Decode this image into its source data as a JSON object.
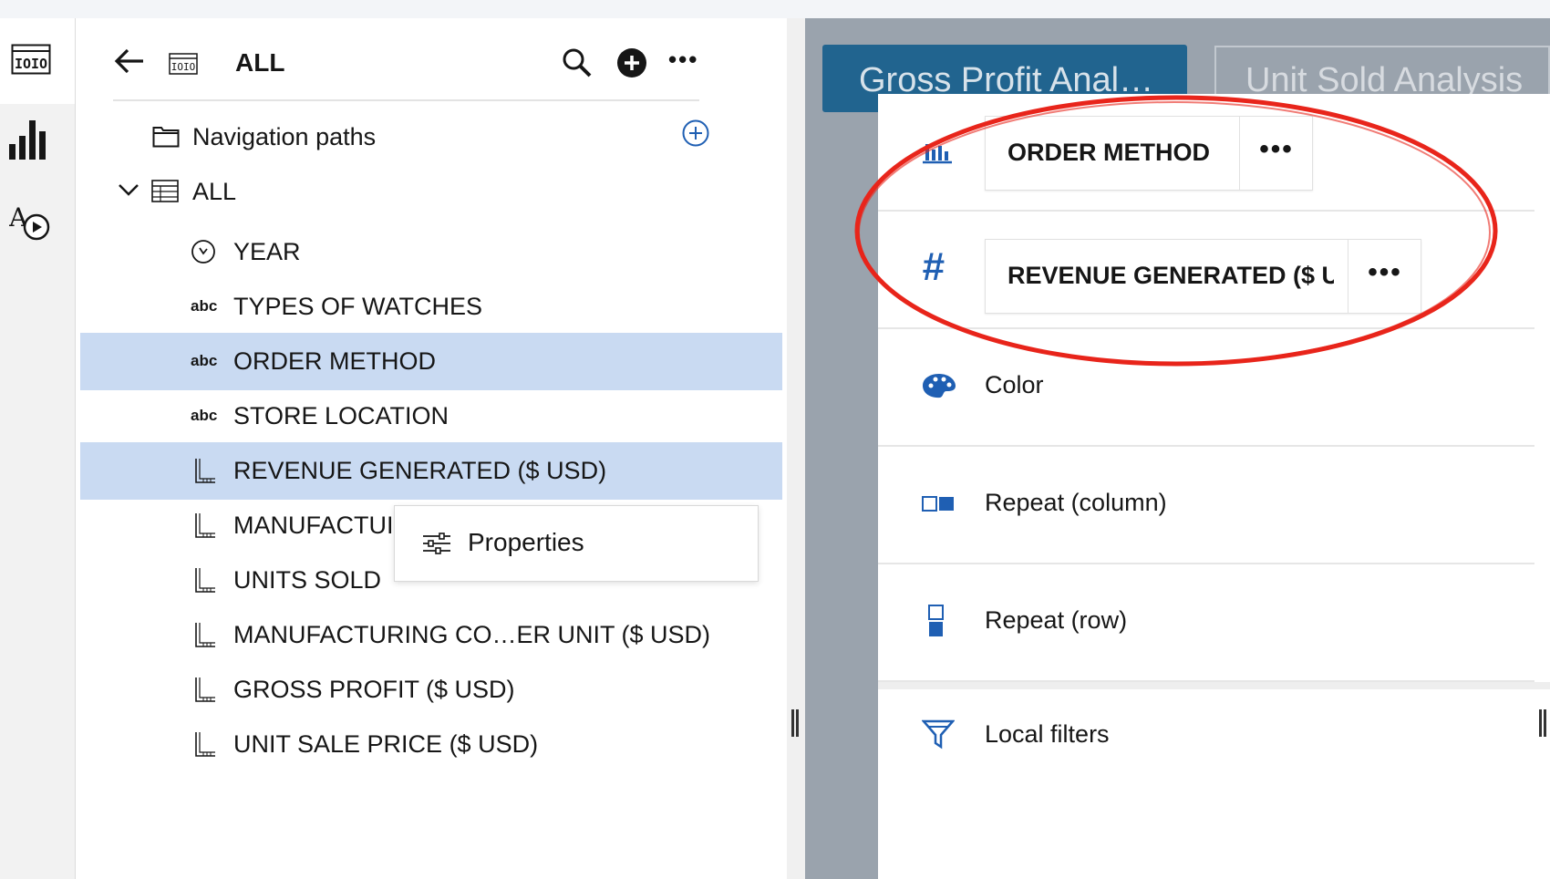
{
  "header": {
    "title": "ALL"
  },
  "tree": {
    "nav_paths_label": "Navigation paths",
    "root_label": "ALL",
    "items": [
      {
        "label": "YEAR",
        "type": "time"
      },
      {
        "label": "TYPES OF WATCHES",
        "type": "abc",
        "type_label": "abc"
      },
      {
        "label": "ORDER METHOD",
        "type": "abc",
        "type_label": "abc"
      },
      {
        "label": "STORE LOCATION",
        "type": "abc",
        "type_label": "abc"
      },
      {
        "label": "REVENUE GENERATED ($ USD)",
        "type": "measure"
      },
      {
        "label": "MANUFACTUI",
        "type": "measure"
      },
      {
        "label": "UNITS SOLD",
        "type": "measure"
      },
      {
        "label": "MANUFACTURING CO…ER UNIT ($ USD)",
        "type": "measure"
      },
      {
        "label": "GROSS PROFIT ($ USD)",
        "type": "measure"
      },
      {
        "label": "UNIT SALE PRICE ($ USD)",
        "type": "measure"
      }
    ]
  },
  "context_menu": {
    "properties_label": "Properties"
  },
  "tabs": [
    {
      "label": "Gross Profit Anal…"
    },
    {
      "label": "Unit Sold Analysis"
    }
  ],
  "slots": {
    "order_method": {
      "value": "ORDER METHOD",
      "more": "•••"
    },
    "revenue": {
      "value": "REVENUE GENERATED ($ USD)",
      "more": "•••"
    },
    "color_label": "Color",
    "repeat_column_label": "Repeat (column)",
    "repeat_row_label": "Repeat (row)",
    "local_filters_label": "Local filters"
  },
  "colors": {
    "accent": "#1f5fb3",
    "selection": "#c9daf2",
    "tab_active": "#21648f",
    "annotation": "#e8251b"
  },
  "icons": {
    "more": "•••"
  }
}
